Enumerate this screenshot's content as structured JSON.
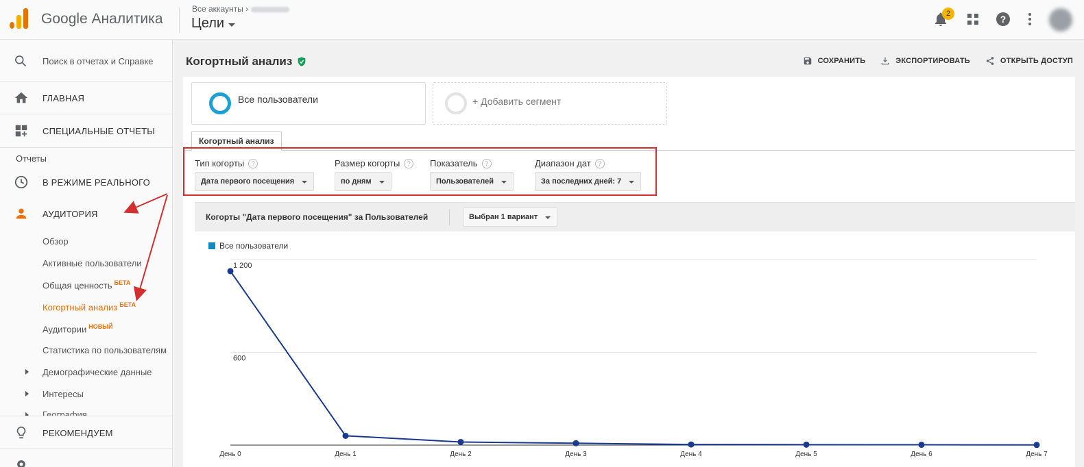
{
  "header": {
    "brand": "Google Аналитика",
    "breadcrumb": "Все аккаунты",
    "view_title": "Цели",
    "notifications_count": "2"
  },
  "sidebar": {
    "search_placeholder": "Поиск в отчетах и Справке",
    "home": "ГЛАВНАЯ",
    "custom_reports": "СПЕЦИАЛЬНЫЕ ОТЧЕТЫ",
    "reports_section": "Отчеты",
    "realtime": "В РЕЖИМЕ РЕАЛЬНОГО",
    "audience": "АУДИТОРИЯ",
    "audience_items": [
      {
        "label": "Обзор"
      },
      {
        "label": "Активные пользователи"
      },
      {
        "label": "Общая ценность",
        "badge": "БЕТА"
      },
      {
        "label": "Когортный анализ",
        "badge": "БЕТА"
      },
      {
        "label": "Аудитории",
        "badge": "НОВЫЙ"
      },
      {
        "label": "Статистика по пользователям"
      },
      {
        "label": "Демографические данные"
      },
      {
        "label": "Интересы"
      },
      {
        "label": "География"
      }
    ],
    "recommend": "РЕКОМЕНДУЕМ"
  },
  "report": {
    "title": "Когортный анализ",
    "actions": {
      "save": "СОХРАНИТЬ",
      "export": "ЭКСПОРТИРОВАТЬ",
      "share": "ОТКРЫТЬ ДОСТУП"
    },
    "segments": {
      "all_users": "Все пользователи",
      "add_segment": "+ Добавить сегмент"
    },
    "tab": "Когортный анализ",
    "controls": {
      "cohort_type_label": "Тип когорты",
      "cohort_type_value": "Дата первого посещения",
      "cohort_size_label": "Размер когорты",
      "cohort_size_value": "по дням",
      "metric_label": "Показатель",
      "metric_value": "Пользователей",
      "date_range_label": "Диапазон дат",
      "date_range_value": "За последних дней: 7"
    },
    "chart_header": {
      "title": "Когорты \"Дата первого посещения\" за Пользователей",
      "variant_select": "Выбран 1 вариант"
    }
  },
  "colors": {
    "accent": "#e8710a",
    "series": "#1a3a8f",
    "legend": "#0e8ac0",
    "highlight": "#d32f2f"
  },
  "chart_data": {
    "type": "line",
    "categories": [
      "День 0",
      "День 1",
      "День 2",
      "День 3",
      "День 4",
      "День 5",
      "День 6",
      "День 7"
    ],
    "series": [
      {
        "name": "Все пользователи",
        "values": [
          1125,
          60,
          20,
          12,
          4,
          3,
          2,
          1
        ]
      }
    ],
    "ytick_labels": [
      "1 200",
      "600"
    ],
    "yticks": [
      1200,
      600
    ],
    "ylim": [
      0,
      1200
    ],
    "grid": true,
    "legend": "top-left"
  }
}
